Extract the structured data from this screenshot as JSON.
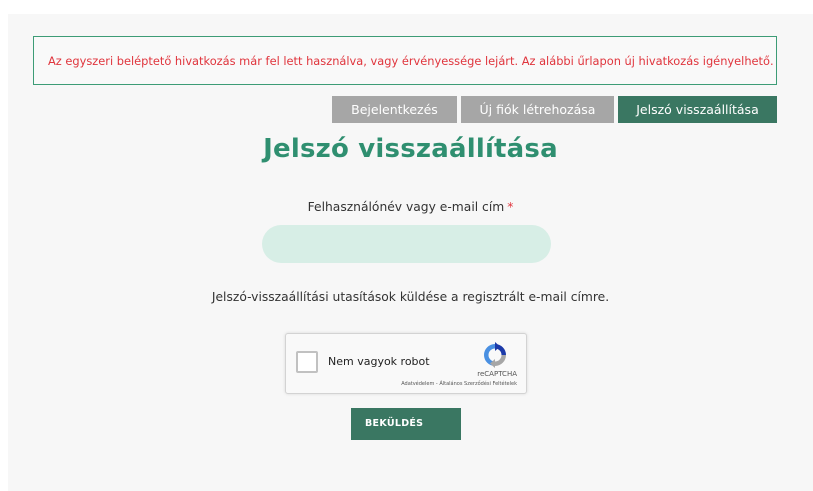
{
  "error_message": "Az egyszeri beléptető hivatkozás már fel lett használva, vagy érvényessége lejárt. Az alábbi űrlapon új hivatkozás igényelhető.",
  "tabs": [
    {
      "label": "Bejelentkezés",
      "active": false
    },
    {
      "label": "Új fiók létrehozása",
      "active": false
    },
    {
      "label": "Jelszó visszaállítása",
      "active": true
    }
  ],
  "title": "Jelszó visszaállítása",
  "username_field": {
    "label": "Felhasználónév vagy e-mail cím",
    "required_marker": "*",
    "value": "",
    "placeholder": ""
  },
  "instructions": "Jelszó-visszaállítási utasítások küldése a regisztrált e-mail címre.",
  "captcha": {
    "label": "Nem vagyok robot",
    "brand": "reCAPTCHA",
    "privacy_link": "Adatvédelem",
    "separator": " - ",
    "terms_link": "Általános Szerződési Feltételek"
  },
  "submit_label": "BEKÜLDÉS",
  "colors": {
    "accent_green": "#3a7762",
    "title_green": "#2f8f70",
    "error_red": "#e0353d",
    "inactive_tab": "#a6a6a6",
    "input_bg": "#d7eee6"
  }
}
